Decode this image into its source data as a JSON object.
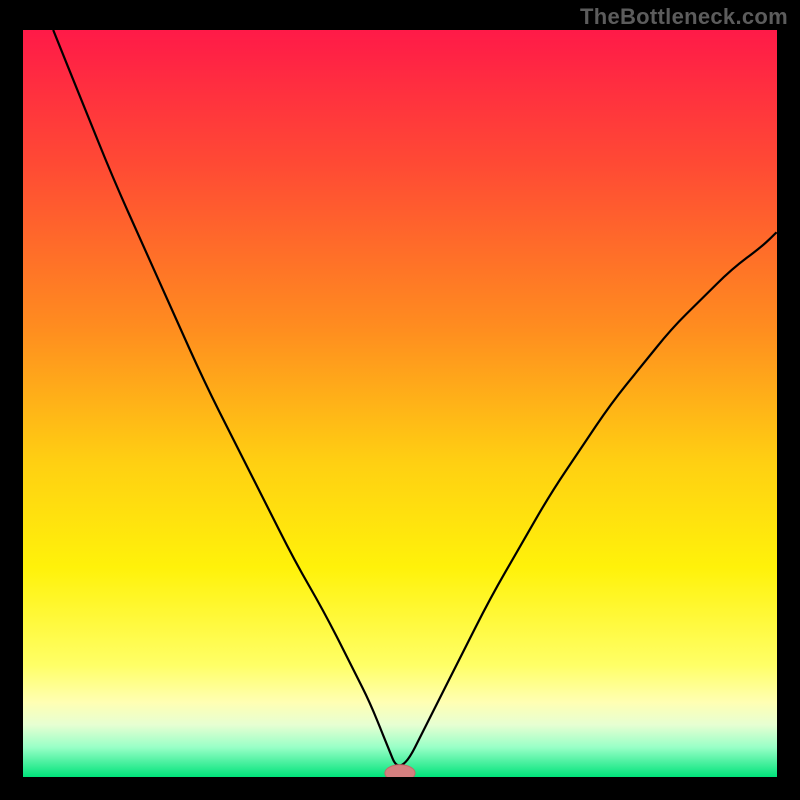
{
  "watermark": "TheBottleneck.com",
  "colors": {
    "frame_bg": "#000000",
    "watermark": "#5c5c5c",
    "curve": "#000000",
    "marker_fill": "#d47f7f",
    "marker_stroke": "#c46868",
    "gradient_stops": [
      {
        "offset": 0.0,
        "color": "#ff1a48"
      },
      {
        "offset": 0.18,
        "color": "#ff4a34"
      },
      {
        "offset": 0.4,
        "color": "#ff8d1f"
      },
      {
        "offset": 0.58,
        "color": "#ffd012"
      },
      {
        "offset": 0.72,
        "color": "#fff20a"
      },
      {
        "offset": 0.85,
        "color": "#ffff66"
      },
      {
        "offset": 0.9,
        "color": "#ffffb3"
      },
      {
        "offset": 0.93,
        "color": "#e7ffd2"
      },
      {
        "offset": 0.96,
        "color": "#99ffc7"
      },
      {
        "offset": 1.0,
        "color": "#00e37a"
      }
    ]
  },
  "chart_data": {
    "type": "line",
    "title": "",
    "xlabel": "",
    "ylabel": "",
    "xlim": [
      0,
      100
    ],
    "ylim": [
      0,
      100
    ],
    "grid": false,
    "legend": false,
    "series": [
      {
        "name": "bottleneck-curve",
        "x": [
          4,
          8,
          12,
          16,
          20,
          24,
          28,
          32,
          36,
          40,
          44,
          46,
          48,
          50,
          54,
          58,
          62,
          66,
          70,
          74,
          78,
          82,
          86,
          90,
          94,
          98,
          100
        ],
        "y": [
          100,
          90,
          80,
          71,
          62,
          53,
          45,
          37,
          29,
          22,
          14,
          10,
          5,
          0,
          8,
          16,
          24,
          31,
          38,
          44,
          50,
          55,
          60,
          64,
          68,
          71,
          73
        ]
      }
    ],
    "marker": {
      "x": 50,
      "y": 0,
      "rx": 2.0,
      "ry": 1.1
    }
  }
}
